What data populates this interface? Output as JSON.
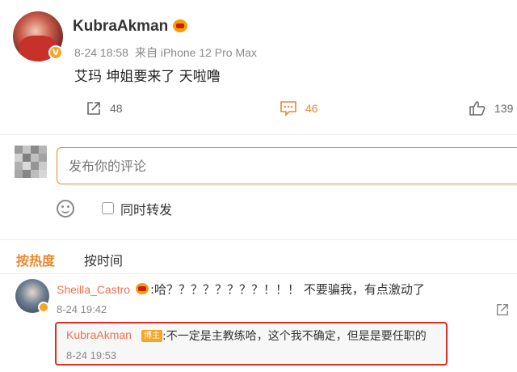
{
  "post": {
    "author": "KubraAkman",
    "verified_mark": "V",
    "date": "8-24 18:58",
    "source": "来自 iPhone 12 Pro Max",
    "text": "艾玛 坤姐要来了 天啦噜",
    "actions": {
      "share_count": "48",
      "comment_count": "46",
      "like_count": "139"
    }
  },
  "composer": {
    "placeholder": "发布你的评论",
    "repost_label": "同时转发"
  },
  "sort_tabs": {
    "hot": "按热度",
    "time": "按时间"
  },
  "comment": {
    "author": "Sheilla_Castro",
    "text": ":哈？？？？？？？？！！！ 不要骗我，有点激动了",
    "time": "8-24 19:42"
  },
  "reply": {
    "author": "KubraAkman",
    "tag": "博主",
    "text": ":不一定是主教练哈，这个我不确定，但是是要任职的",
    "time": "8-24 19:53"
  },
  "colors": {
    "accent": "#e8892c",
    "username_link": "#eb7350",
    "highlight_box": "#d93025",
    "text": "#333333",
    "muted": "#888888"
  },
  "icons": {
    "share": "share-icon",
    "comment": "comment-icon",
    "like": "thumbs-up-icon",
    "emoji": "emoji-icon",
    "medal": "medal-icon"
  }
}
